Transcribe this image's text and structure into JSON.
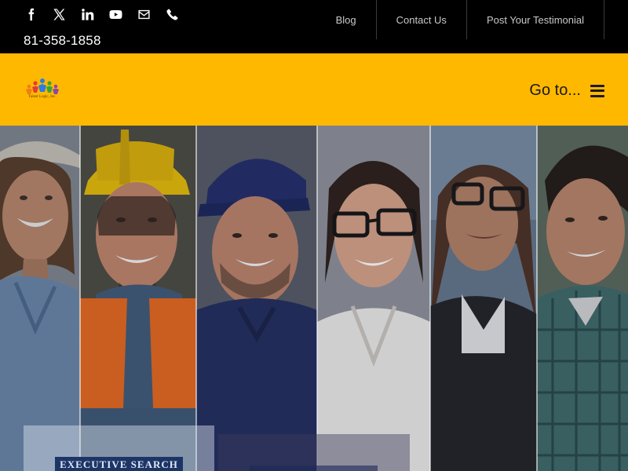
{
  "topbar": {
    "phone_number": "81-358-1858",
    "social_icons": [
      "facebook-icon",
      "x-twitter-icon",
      "linkedin-icon",
      "youtube-icon",
      "envelope-icon",
      "phone-icon"
    ],
    "nav": [
      {
        "label": "Blog"
      },
      {
        "label": "Contact Us"
      },
      {
        "label": "Post Your Testimonial"
      }
    ]
  },
  "header": {
    "logo_text": "Talent Logic, Inc.",
    "menu_label": "Go to...",
    "accent_color": "#ffb800"
  },
  "hero": {
    "card_button": "EXECUTIVE SEARCH"
  }
}
